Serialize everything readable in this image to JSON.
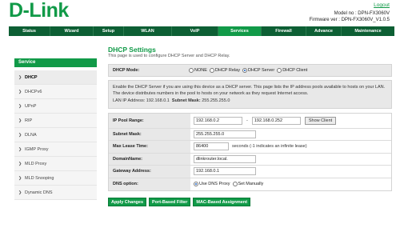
{
  "header": {
    "logo": "D-Link",
    "logout": "Logout",
    "model_label": "Model no : DPN-FX3060V",
    "firmware_label": "Firmware ver : DPN-FX3060V_V1.0.5"
  },
  "nav": {
    "tabs": [
      {
        "label": "Status",
        "active": false
      },
      {
        "label": "Wizard",
        "active": false
      },
      {
        "label": "Setup",
        "active": false
      },
      {
        "label": "WLAN",
        "active": false
      },
      {
        "label": "VoIP",
        "active": false
      },
      {
        "label": "Services",
        "active": true
      },
      {
        "label": "Firewall",
        "active": false
      },
      {
        "label": "Advance",
        "active": false
      },
      {
        "label": "Maintenance",
        "active": false
      }
    ]
  },
  "sidebar": {
    "header": "Service",
    "items": [
      {
        "label": "DHCP",
        "active": true
      },
      {
        "label": "DHCPv6",
        "active": false
      },
      {
        "label": "UPnP",
        "active": false
      },
      {
        "label": "RIP",
        "active": false
      },
      {
        "label": "DLNA",
        "active": false
      },
      {
        "label": "IGMP Proxy",
        "active": false
      },
      {
        "label": "MLD Proxy",
        "active": false
      },
      {
        "label": "MLD Snooping",
        "active": false
      },
      {
        "label": "Dynamic DNS",
        "active": false
      }
    ]
  },
  "main": {
    "title": "DHCP Settings",
    "subtitle": "This page is used to configure DHCP Server and DHCP Relay.",
    "mode": {
      "label": "DHCP Mode:",
      "options": [
        {
          "label": "NONE",
          "selected": false
        },
        {
          "label": "DHCP Relay",
          "selected": false
        },
        {
          "label": "DHCP Server",
          "selected": true
        },
        {
          "label": "DHCP Client",
          "selected": false
        }
      ]
    },
    "description": "Enable the DHCP Server if you are using this device as a DHCP server. This page lists the IP address pools available to hosts on your LAN. The device distributes numbers in the pool to hosts on your network as they request Internet access.",
    "lan_ip_label": "LAN IP Address:",
    "lan_ip": "192.168.0.1",
    "subnet_label": "Subnet Mask:",
    "subnet": "255.255.255.0",
    "form": {
      "pool_label": "IP Pool Range:",
      "pool_start": "192.168.0.2",
      "pool_dash": "-",
      "pool_end": "192.168.0.252",
      "show_client": "Show Client",
      "subnet_mask_label": "Subnet Mask:",
      "subnet_mask": "255.255.255.0",
      "lease_label": "Max Lease Time:",
      "lease_value": "86400",
      "lease_hint": "seconds (-1 indicates an infinite lease)",
      "domain_label": "DomainName:",
      "domain_value": "dlinkrouter.local.",
      "gateway_label": "Gateway Address:",
      "gateway_value": "192.168.0.1",
      "dns_label": "DNS option:",
      "dns_options": [
        {
          "label": "Use DNS Proxy",
          "selected": true
        },
        {
          "label": "Set Manually",
          "selected": false
        }
      ]
    },
    "buttons": {
      "apply": "Apply Changes",
      "port_filter": "Port-Based Filter",
      "mac_assign": "MAC-Based Assignment"
    }
  },
  "colors": {
    "brand_green": "#119a48",
    "nav_dark_green": "#0d5f34",
    "panel_gray": "#e8e8e8"
  }
}
